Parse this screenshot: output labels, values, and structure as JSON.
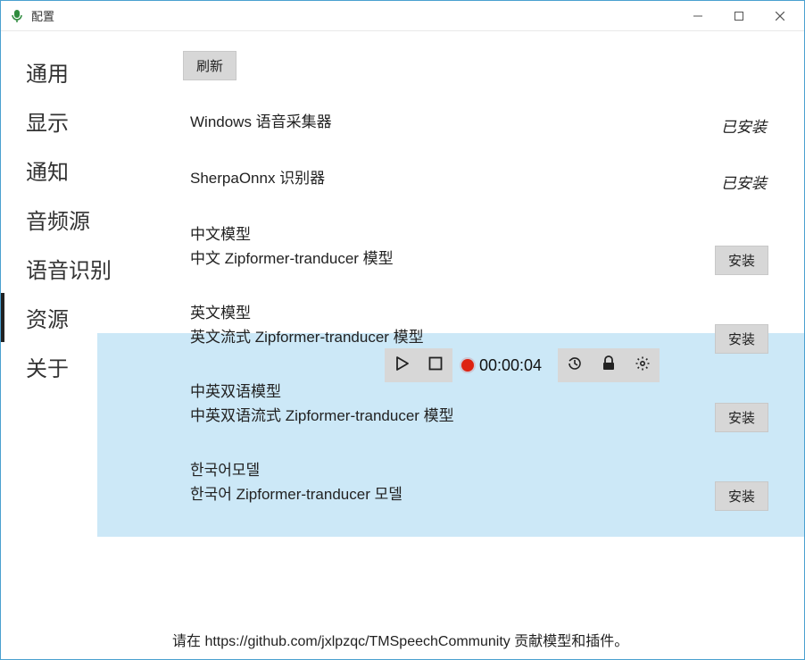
{
  "window": {
    "title": "配置"
  },
  "sidebar": {
    "items": [
      {
        "label": "通用"
      },
      {
        "label": "显示"
      },
      {
        "label": "通知"
      },
      {
        "label": "音频源"
      },
      {
        "label": "语音识别"
      },
      {
        "label": "资源"
      },
      {
        "label": "关于"
      }
    ],
    "active_index": 5
  },
  "toolbar": {
    "refresh_label": "刷新"
  },
  "resources": [
    {
      "name": "Windows 语音采集器",
      "desc": "",
      "installed": true,
      "installed_label": "已安装"
    },
    {
      "name": "SherpaOnnx 识别器",
      "desc": "",
      "installed": true,
      "installed_label": "已安装"
    },
    {
      "name": "中文模型",
      "desc": "中文 Zipformer-tranducer 模型",
      "installed": false,
      "install_label": "安装"
    },
    {
      "name": "英文模型",
      "desc": "英文流式 Zipformer-tranducer 模型",
      "installed": false,
      "install_label": "安装"
    },
    {
      "name": "中英双语模型",
      "desc": "中英双语流式 Zipformer-tranducer 模型",
      "installed": false,
      "install_label": "安装"
    },
    {
      "name": "한국어모델",
      "desc": "한국어 Zipformer-tranducer 모델",
      "installed": false,
      "install_label": "安装"
    }
  ],
  "recorder_overlay": {
    "timer": "00:00:04"
  },
  "footer": {
    "note": "请在 https://github.com/jxlpzqc/TMSpeechCommunity 贡献模型和插件。"
  }
}
